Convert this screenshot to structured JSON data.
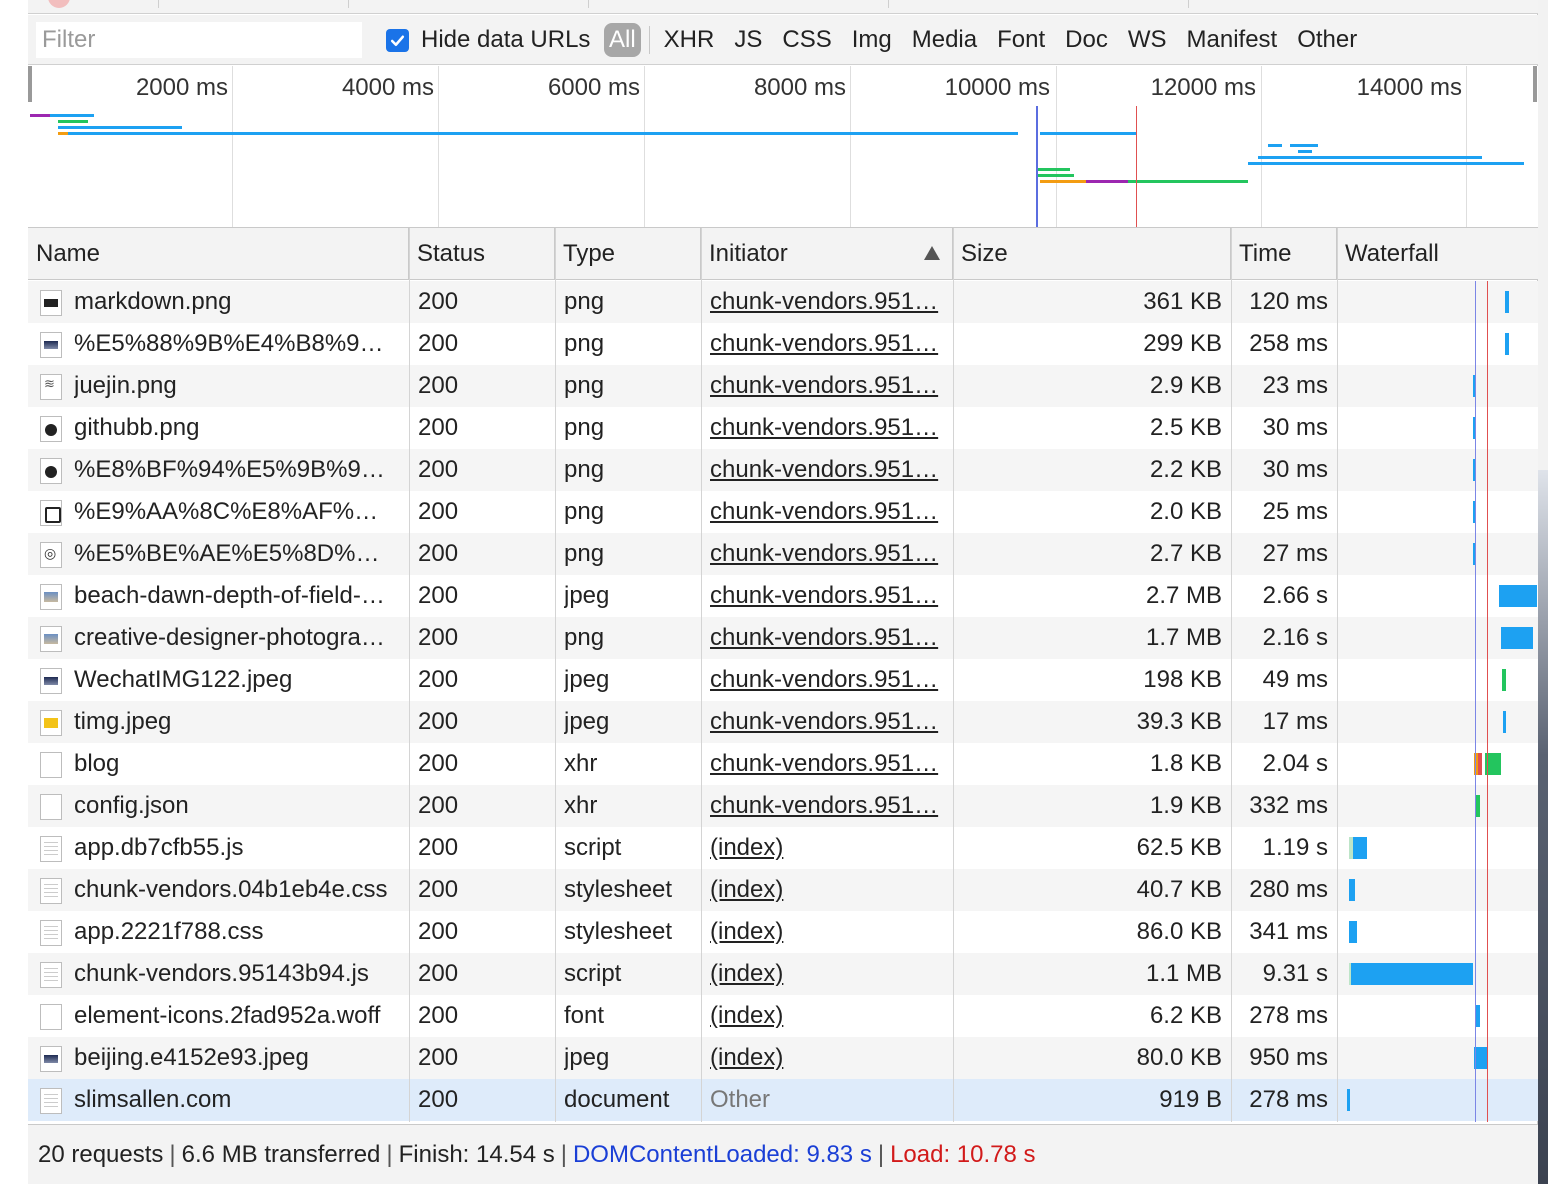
{
  "filter": {
    "placeholder": "Filter",
    "value": ""
  },
  "hide_data_urls": {
    "label": "Hide data URLs",
    "checked": true
  },
  "type_filters": [
    "All",
    "XHR",
    "JS",
    "CSS",
    "Img",
    "Media",
    "Font",
    "Doc",
    "WS",
    "Manifest",
    "Other"
  ],
  "active_type_filter": "All",
  "overview": {
    "ticks": [
      "2000 ms",
      "4000 ms",
      "6000 ms",
      "8000 ms",
      "10000 ms",
      "12000 ms",
      "14000 ms"
    ]
  },
  "columns": [
    "Name",
    "Status",
    "Type",
    "Initiator",
    "Size",
    "Time",
    "Waterfall"
  ],
  "sorted_column": "Initiator",
  "sort_direction": "ascending",
  "rows": [
    {
      "name": "markdown.png",
      "status": "200",
      "type": "png",
      "initiator": "chunk-vendors.951…",
      "size": "361 KB",
      "time": "120 ms",
      "icon": "image-dark-icon"
    },
    {
      "name": "%E5%88%9B%E4%B8%9…",
      "status": "200",
      "type": "png",
      "initiator": "chunk-vendors.951…",
      "size": "299 KB",
      "time": "258 ms",
      "icon": "image-navy-icon"
    },
    {
      "name": "juejin.png",
      "status": "200",
      "type": "png",
      "initiator": "chunk-vendors.951…",
      "size": "2.9 KB",
      "time": "23 ms",
      "icon": "image-juejin-icon"
    },
    {
      "name": "githubb.png",
      "status": "200",
      "type": "png",
      "initiator": "chunk-vendors.951…",
      "size": "2.5 KB",
      "time": "30 ms",
      "icon": "image-github-icon"
    },
    {
      "name": "%E8%BF%94%E5%9B%9…",
      "status": "200",
      "type": "png",
      "initiator": "chunk-vendors.951…",
      "size": "2.2 KB",
      "time": "30 ms",
      "icon": "image-round-icon"
    },
    {
      "name": "%E9%AA%8C%E8%AF%…",
      "status": "200",
      "type": "png",
      "initiator": "chunk-vendors.951…",
      "size": "2.0 KB",
      "time": "25 ms",
      "icon": "image-calendar-icon"
    },
    {
      "name": "%E5%BE%AE%E5%8D%…",
      "status": "200",
      "type": "png",
      "initiator": "chunk-vendors.951…",
      "size": "2.7 KB",
      "time": "27 ms",
      "icon": "image-weibo-icon"
    },
    {
      "name": "beach-dawn-depth-of-field-…",
      "status": "200",
      "type": "jpeg",
      "initiator": "chunk-vendors.951…",
      "size": "2.7 MB",
      "time": "2.66 s",
      "icon": "image-photo-icon"
    },
    {
      "name": "creative-designer-photogra…",
      "status": "200",
      "type": "png",
      "initiator": "chunk-vendors.951…",
      "size": "1.7 MB",
      "time": "2.16 s",
      "icon": "image-photo-icon"
    },
    {
      "name": "WechatIMG122.jpeg",
      "status": "200",
      "type": "jpeg",
      "initiator": "chunk-vendors.951…",
      "size": "198 KB",
      "time": "49 ms",
      "icon": "image-navy-icon"
    },
    {
      "name": "timg.jpeg",
      "status": "200",
      "type": "jpeg",
      "initiator": "chunk-vendors.951…",
      "size": "39.3 KB",
      "time": "17 ms",
      "icon": "image-yellow-icon"
    },
    {
      "name": "blog",
      "status": "200",
      "type": "xhr",
      "initiator": "chunk-vendors.951…",
      "size": "1.8 KB",
      "time": "2.04 s",
      "icon": "blank-file-icon"
    },
    {
      "name": "config.json",
      "status": "200",
      "type": "xhr",
      "initiator": "chunk-vendors.951…",
      "size": "1.9 KB",
      "time": "332 ms",
      "icon": "blank-file-icon"
    },
    {
      "name": "app.db7cfb55.js",
      "status": "200",
      "type": "script",
      "initiator": "(index)",
      "size": "62.5 KB",
      "time": "1.19 s",
      "icon": "document-file-icon"
    },
    {
      "name": "chunk-vendors.04b1eb4e.css",
      "status": "200",
      "type": "stylesheet",
      "initiator": "(index)",
      "size": "40.7 KB",
      "time": "280 ms",
      "icon": "document-file-icon"
    },
    {
      "name": "app.2221f788.css",
      "status": "200",
      "type": "stylesheet",
      "initiator": "(index)",
      "size": "86.0 KB",
      "time": "341 ms",
      "icon": "document-file-icon"
    },
    {
      "name": "chunk-vendors.95143b94.js",
      "status": "200",
      "type": "script",
      "initiator": "(index)",
      "size": "1.1 MB",
      "time": "9.31 s",
      "icon": "document-file-icon"
    },
    {
      "name": "element-icons.2fad952a.woff",
      "status": "200",
      "type": "font",
      "initiator": "(index)",
      "size": "6.2 KB",
      "time": "278 ms",
      "icon": "blank-file-icon"
    },
    {
      "name": "beijing.e4152e93.jpeg",
      "status": "200",
      "type": "jpeg",
      "initiator": "(index)",
      "size": "80.0 KB",
      "time": "950 ms",
      "icon": "image-navy-icon"
    },
    {
      "name": "slimsallen.com",
      "status": "200",
      "type": "document",
      "initiator": "Other",
      "size": "919 B",
      "time": "278 ms",
      "icon": "document-file-icon"
    }
  ],
  "summary": {
    "requests": "20 requests",
    "transferred": "6.6 MB transferred",
    "finish": "Finish: 14.54 s",
    "dom_content_loaded": "DOMContentLoaded: 9.83 s",
    "load": "Load: 10.78 s"
  },
  "colors": {
    "dom_content_loaded": "#1a3fd6",
    "load": "#d21a1a",
    "waterfall_receive": "#1da1f2",
    "waterfall_wait": "#23c55e",
    "checkbox": "#1a73e8"
  }
}
